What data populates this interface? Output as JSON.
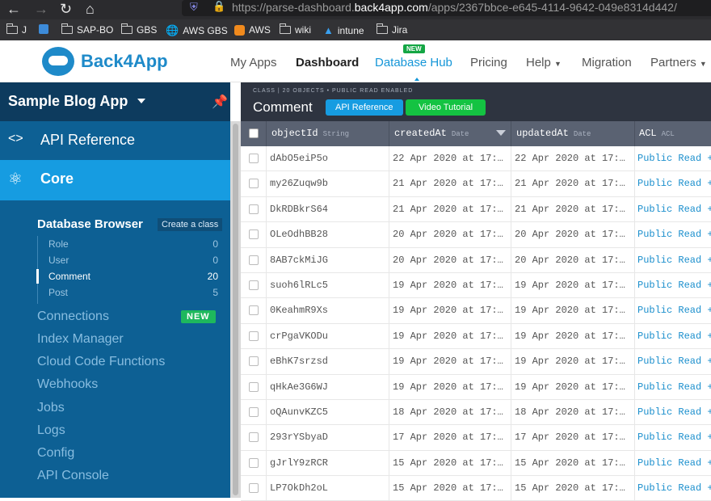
{
  "browser": {
    "url_prefix": "https://parse-dashboard.",
    "url_domain": "back4app.com",
    "url_suffix": "/apps/2367bbce-e645-4114-9642-049e8314d442/",
    "bookmarks": [
      "J",
      "SAP-BO",
      "GBS",
      "AWS GBS",
      "AWS",
      "wiki",
      "intune",
      "Jira"
    ]
  },
  "topnav": {
    "logo": "Back4App",
    "items": [
      "My Apps",
      "Dashboard",
      "Database Hub",
      "Pricing",
      "Help",
      "Migration",
      "Partners"
    ],
    "new_tag": "NEW"
  },
  "sidebar": {
    "app_name": "Sample Blog App",
    "api_reference": "API Reference",
    "core": "Core",
    "db_browser": "Database Browser",
    "create_class": "Create a class",
    "classes": [
      {
        "name": "Role",
        "count": "0"
      },
      {
        "name": "User",
        "count": "0"
      },
      {
        "name": "Comment",
        "count": "20"
      },
      {
        "name": "Post",
        "count": "5"
      }
    ],
    "links": [
      "Connections",
      "Index Manager",
      "Cloud Code Functions",
      "Webhooks",
      "Jobs",
      "Logs",
      "Config",
      "API Console"
    ],
    "new_badge": "NEW"
  },
  "classbar": {
    "meta": "CLASS | 20 OBJECTS • PUBLIC READ ENABLED",
    "name": "Comment",
    "api_reference": "API Reference",
    "video_tutorial": "Video Tutorial"
  },
  "table": {
    "columns": [
      {
        "name": "objectId",
        "type": "String"
      },
      {
        "name": "createdAt",
        "type": "Date"
      },
      {
        "name": "updatedAt",
        "type": "Date"
      },
      {
        "name": "ACL",
        "type": "ACL"
      }
    ],
    "rows": [
      {
        "id": "dAbO5eiP5o",
        "created": "22 Apr 2020 at 17:…",
        "updated": "22 Apr 2020 at 17:…",
        "acl": "Public Read +"
      },
      {
        "id": "my26Zuqw9b",
        "created": "21 Apr 2020 at 17:…",
        "updated": "21 Apr 2020 at 17:…",
        "acl": "Public Read +"
      },
      {
        "id": "DkRDBkrS64",
        "created": "21 Apr 2020 at 17:…",
        "updated": "21 Apr 2020 at 17:…",
        "acl": "Public Read +"
      },
      {
        "id": "OLeOdhBB28",
        "created": "20 Apr 2020 at 17:…",
        "updated": "20 Apr 2020 at 17:…",
        "acl": "Public Read +"
      },
      {
        "id": "8AB7ckMiJG",
        "created": "20 Apr 2020 at 17:…",
        "updated": "20 Apr 2020 at 17:…",
        "acl": "Public Read +"
      },
      {
        "id": "suoh6lRLc5",
        "created": "19 Apr 2020 at 17:…",
        "updated": "19 Apr 2020 at 17:…",
        "acl": "Public Read +"
      },
      {
        "id": "0KeahmR9Xs",
        "created": "19 Apr 2020 at 17:…",
        "updated": "19 Apr 2020 at 17:…",
        "acl": "Public Read +"
      },
      {
        "id": "crPgaVKODu",
        "created": "19 Apr 2020 at 17:…",
        "updated": "19 Apr 2020 at 17:…",
        "acl": "Public Read +"
      },
      {
        "id": "eBhK7srzsd",
        "created": "19 Apr 2020 at 17:…",
        "updated": "19 Apr 2020 at 17:…",
        "acl": "Public Read +"
      },
      {
        "id": "qHkAe3G6WJ",
        "created": "19 Apr 2020 at 17:…",
        "updated": "19 Apr 2020 at 17:…",
        "acl": "Public Read +"
      },
      {
        "id": "oQAunvKZC5",
        "created": "18 Apr 2020 at 17:…",
        "updated": "18 Apr 2020 at 17:…",
        "acl": "Public Read +"
      },
      {
        "id": "293rYSbyaD",
        "created": "17 Apr 2020 at 17:…",
        "updated": "17 Apr 2020 at 17:…",
        "acl": "Public Read +"
      },
      {
        "id": "gJrlY9zRCR",
        "created": "15 Apr 2020 at 17:…",
        "updated": "15 Apr 2020 at 17:…",
        "acl": "Public Read +"
      },
      {
        "id": "LP7OkDh2oL",
        "created": "15 Apr 2020 at 17:…",
        "updated": "15 Apr 2020 at 17:…",
        "acl": "Public Read +"
      }
    ]
  },
  "colors": {
    "sidebar": "#0d6094",
    "core_active": "#169ce1",
    "accent": "#1596d8",
    "green": "#14c342"
  },
  "icons": [
    "back-arrow-icon",
    "forward-arrow-icon",
    "reload-icon",
    "home-icon",
    "shield-icon",
    "lock-icon",
    "folder-icon",
    "globe-icon",
    "pin-icon",
    "code-icon",
    "atom-icon",
    "caret-down-icon",
    "sort-arrow-icon",
    "checkbox-icon"
  ]
}
